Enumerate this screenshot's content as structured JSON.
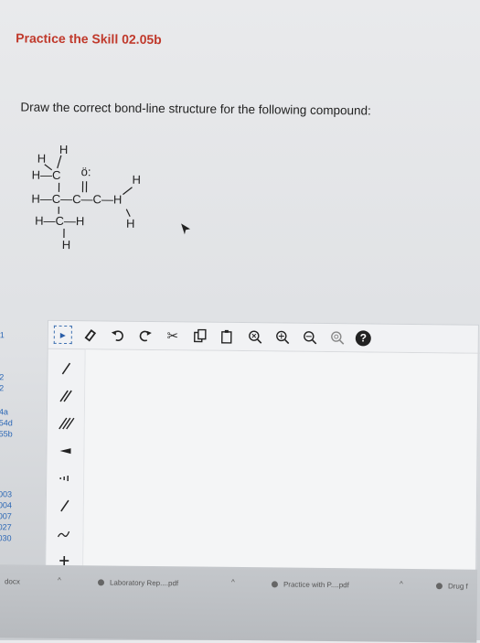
{
  "page": {
    "title": "Practice the Skill 02.05b",
    "instruction": "Draw the correct bond-line structure for the following compound:"
  },
  "molecule": {
    "labels": {
      "h1": "H",
      "h2": "H",
      "c1": "H—C",
      "o": "ö:",
      "h3": "H",
      "rowmid": "H—C—C—C—H",
      "h4": "H",
      "rowlow": "H—C—H",
      "h5": "H"
    }
  },
  "toolbar": {
    "items": [
      "eraser-icon",
      "undo-icon",
      "redo-icon",
      "cut-icon",
      "copy-icon",
      "paste-icon",
      "clear-icon",
      "zoom-in-icon",
      "zoom-out-icon",
      "reset-icon",
      "help-icon"
    ],
    "help_label": "?"
  },
  "sidenav": {
    "items": [
      "1",
      "2",
      "2",
      "4a",
      "54d",
      "55b",
      "003",
      "004",
      "007",
      "027",
      "030"
    ]
  },
  "downloads": {
    "items": [
      "docx",
      "Laboratory Rep....pdf",
      "Practice with P....pdf",
      "Drug f"
    ]
  }
}
